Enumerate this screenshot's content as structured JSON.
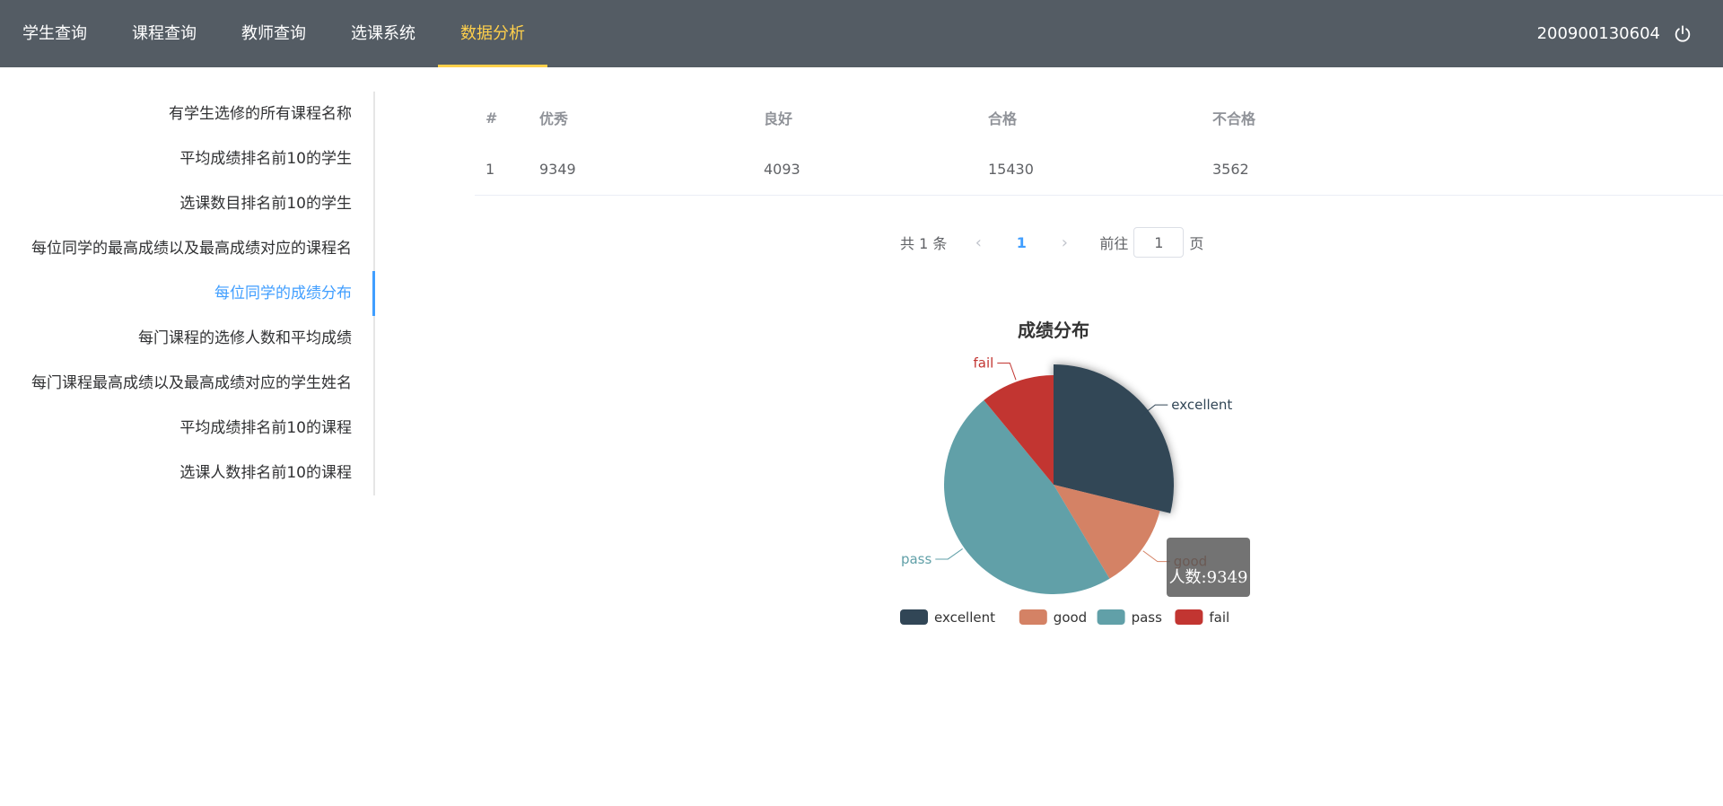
{
  "nav": {
    "items": [
      "学生查询",
      "课程查询",
      "教师查询",
      "选课系统",
      "数据分析"
    ],
    "active_index": 4,
    "user_id": "200900130604",
    "accent_color": "#ffd04b",
    "bg_color": "#545c64"
  },
  "sidebar": {
    "items": [
      "有学生选修的所有课程名称",
      "平均成绩排名前10的学生",
      "选课数目排名前10的学生",
      "每位同学的最高成绩以及最高成绩对应的课程名",
      "每位同学的成绩分布",
      "每门课程的选修人数和平均成绩",
      "每门课程最高成绩以及最高成绩对应的学生姓名",
      "平均成绩排名前10的课程",
      "选课人数排名前10的课程"
    ],
    "active_index": 4,
    "active_color": "#409eff"
  },
  "table": {
    "headers": [
      "#",
      "优秀",
      "良好",
      "合格",
      "不合格"
    ],
    "rows": [
      [
        "1",
        "9349",
        "4093",
        "15430",
        "3562"
      ]
    ]
  },
  "pagination": {
    "total": "共 1 条",
    "current": "1",
    "goto_label": "前往",
    "goto_value": "1",
    "page_label": "页"
  },
  "tooltip": {
    "text": "人数:9349"
  },
  "chart_data": {
    "type": "pie",
    "title": "成绩分布",
    "categories": [
      "excellent",
      "good",
      "pass",
      "fail"
    ],
    "values": [
      9349,
      4093,
      15430,
      3562
    ],
    "colors": [
      "#314656",
      "#d48265",
      "#61a0a8",
      "#c23531"
    ],
    "legend_position": "bottom",
    "highlighted": "excellent"
  }
}
